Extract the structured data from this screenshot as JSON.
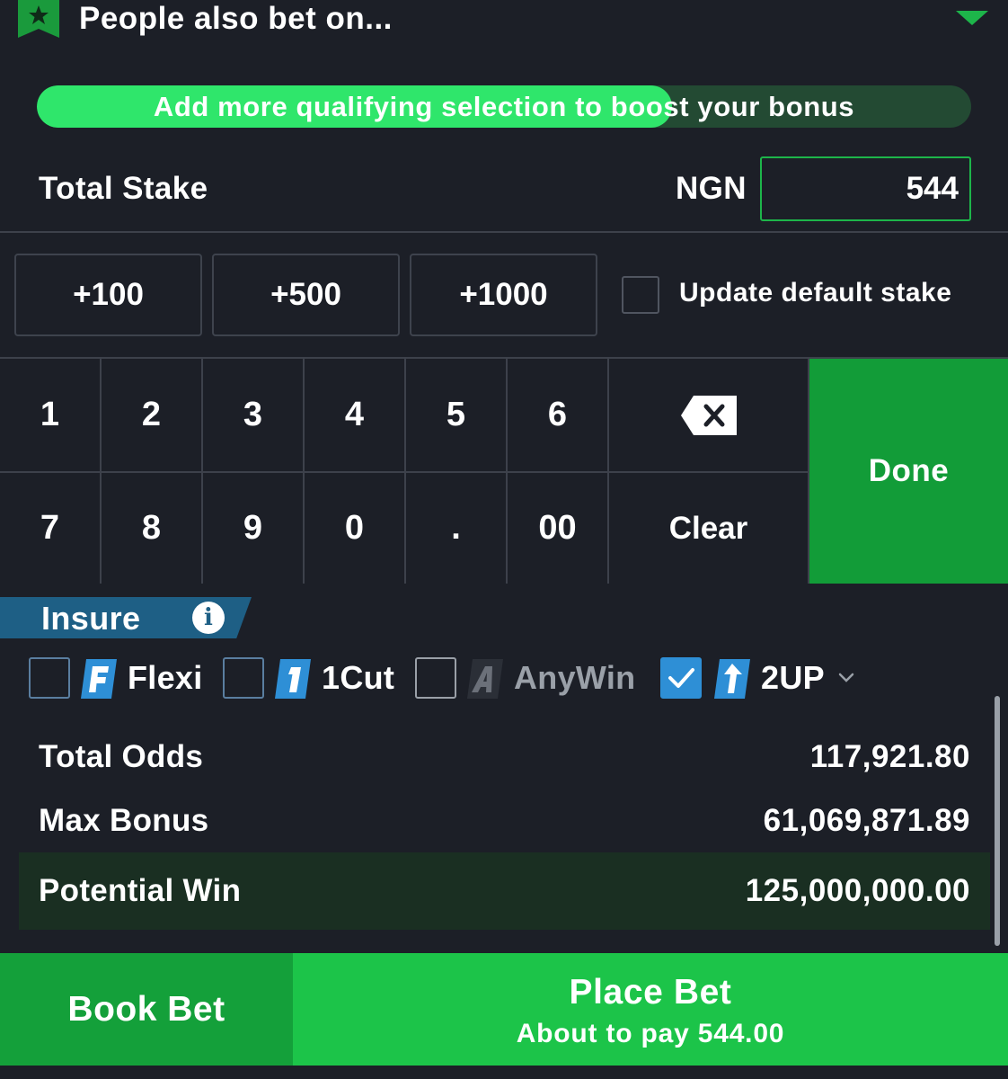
{
  "header": {
    "title": "People also bet on..."
  },
  "boost": {
    "text": "Add more qualifying selection to boost your bonus",
    "progress": 0.68
  },
  "stake": {
    "label": "Total Stake",
    "currency": "NGN",
    "value": "544"
  },
  "quick_stakes": [
    "+100",
    "+500",
    "+1000"
  ],
  "update_default": {
    "label": "Update default stake",
    "checked": false
  },
  "keypad": {
    "row1": [
      "1",
      "2",
      "3",
      "4",
      "5",
      "6"
    ],
    "row2": [
      "7",
      "8",
      "9",
      "0",
      ".",
      "00"
    ],
    "clear": "Clear",
    "done": "Done"
  },
  "insure": {
    "label": "Insure",
    "info_glyph": "i",
    "options": [
      {
        "label": "Flexi",
        "checked": false,
        "icon": "flexi-icon"
      },
      {
        "label": "1Cut",
        "checked": false,
        "icon": "onecut-icon"
      },
      {
        "label": "AnyWin",
        "checked": false,
        "icon": "anywin-icon"
      },
      {
        "label": "2UP",
        "checked": true,
        "icon": "twoup-icon"
      }
    ]
  },
  "summary": {
    "total_odds_label": "Total Odds",
    "total_odds_value": "117,921.80",
    "max_bonus_label": "Max Bonus",
    "max_bonus_value": "61,069,871.89",
    "potential_win_label": "Potential Win",
    "potential_win_value": "125,000,000.00"
  },
  "footer": {
    "book_bet": "Book Bet",
    "place_bet": "Place Bet",
    "place_bet_sub": "About to pay 544.00"
  },
  "colors": {
    "accent_green": "#1cc449",
    "done_green": "#129c38",
    "insure_blue": "#1e5f85",
    "check_blue": "#2e8fd6"
  }
}
